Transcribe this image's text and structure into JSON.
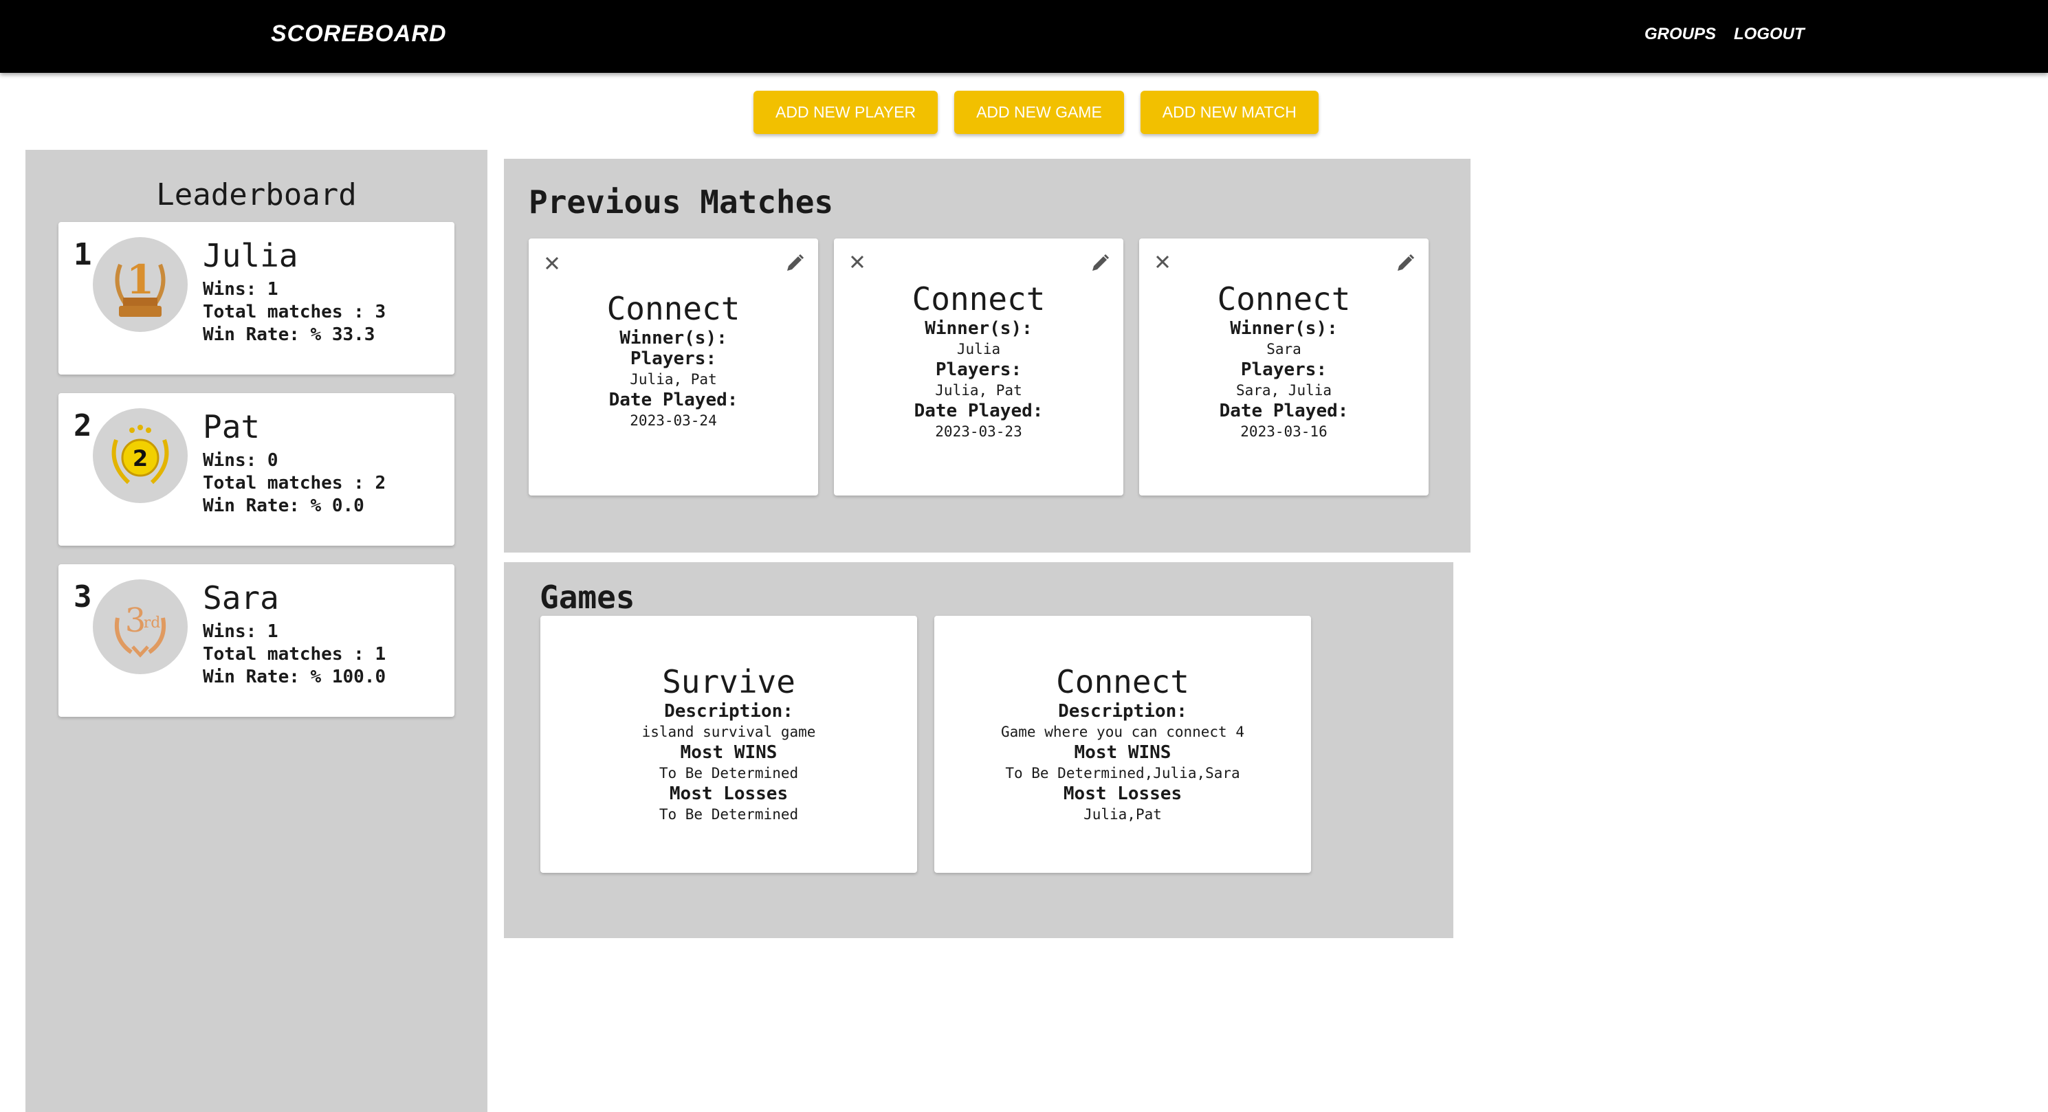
{
  "header": {
    "brand": "SCOREBOARD",
    "nav": {
      "groups": "GROUPS",
      "logout": "LOGOUT"
    }
  },
  "actions": {
    "add_player": "ADD NEW PLAYER",
    "add_game": "ADD NEW GAME",
    "add_match": "ADD NEW MATCH"
  },
  "leaderboard": {
    "title": "Leaderboard",
    "players": [
      {
        "rank": "1",
        "name": "Julia",
        "wins": "Wins: 1",
        "total": "Total matches : 3",
        "rate": "Win Rate: % 33.3",
        "medal_icon": "gold-trophy-medal-icon"
      },
      {
        "rank": "2",
        "name": "Pat",
        "wins": "Wins: 0",
        "total": "Total matches : 2",
        "rate": "Win Rate: % 0.0",
        "medal_icon": "silver-laurel-medal-icon"
      },
      {
        "rank": "3",
        "name": "Sara",
        "wins": "Wins: 1",
        "total": "Total matches : 1",
        "rate": "Win Rate: % 100.0",
        "medal_icon": "bronze-laurel-medal-icon"
      }
    ]
  },
  "matches": {
    "title": "Previous Matches",
    "labels": {
      "winners": "Winner(s):",
      "players": "Players:",
      "date": "Date Played:"
    },
    "items": [
      {
        "game": "Connect",
        "winners": "",
        "players": "Julia, Pat",
        "date": "2023-03-24"
      },
      {
        "game": "Connect",
        "winners": "Julia",
        "players": "Julia, Pat",
        "date": "2023-03-23"
      },
      {
        "game": "Connect",
        "winners": "Sara",
        "players": "Sara, Julia",
        "date": "2023-03-16"
      }
    ]
  },
  "games": {
    "title": "Games",
    "labels": {
      "description": "Description:",
      "most_wins": "Most WINS",
      "most_losses": "Most Losses"
    },
    "items": [
      {
        "name": "Survive",
        "description": "island survival game",
        "most_wins": "To Be Determined",
        "most_losses": "To Be Determined"
      },
      {
        "name": "Connect",
        "description": "Game where you can connect 4",
        "most_wins": "To Be Determined,Julia,Sara",
        "most_losses": "Julia,Pat"
      }
    ]
  },
  "colors": {
    "header_bg": "#000000",
    "accent": "#f2c000",
    "panel_bg": "#cfcfcf",
    "card_bg": "#ffffff"
  }
}
